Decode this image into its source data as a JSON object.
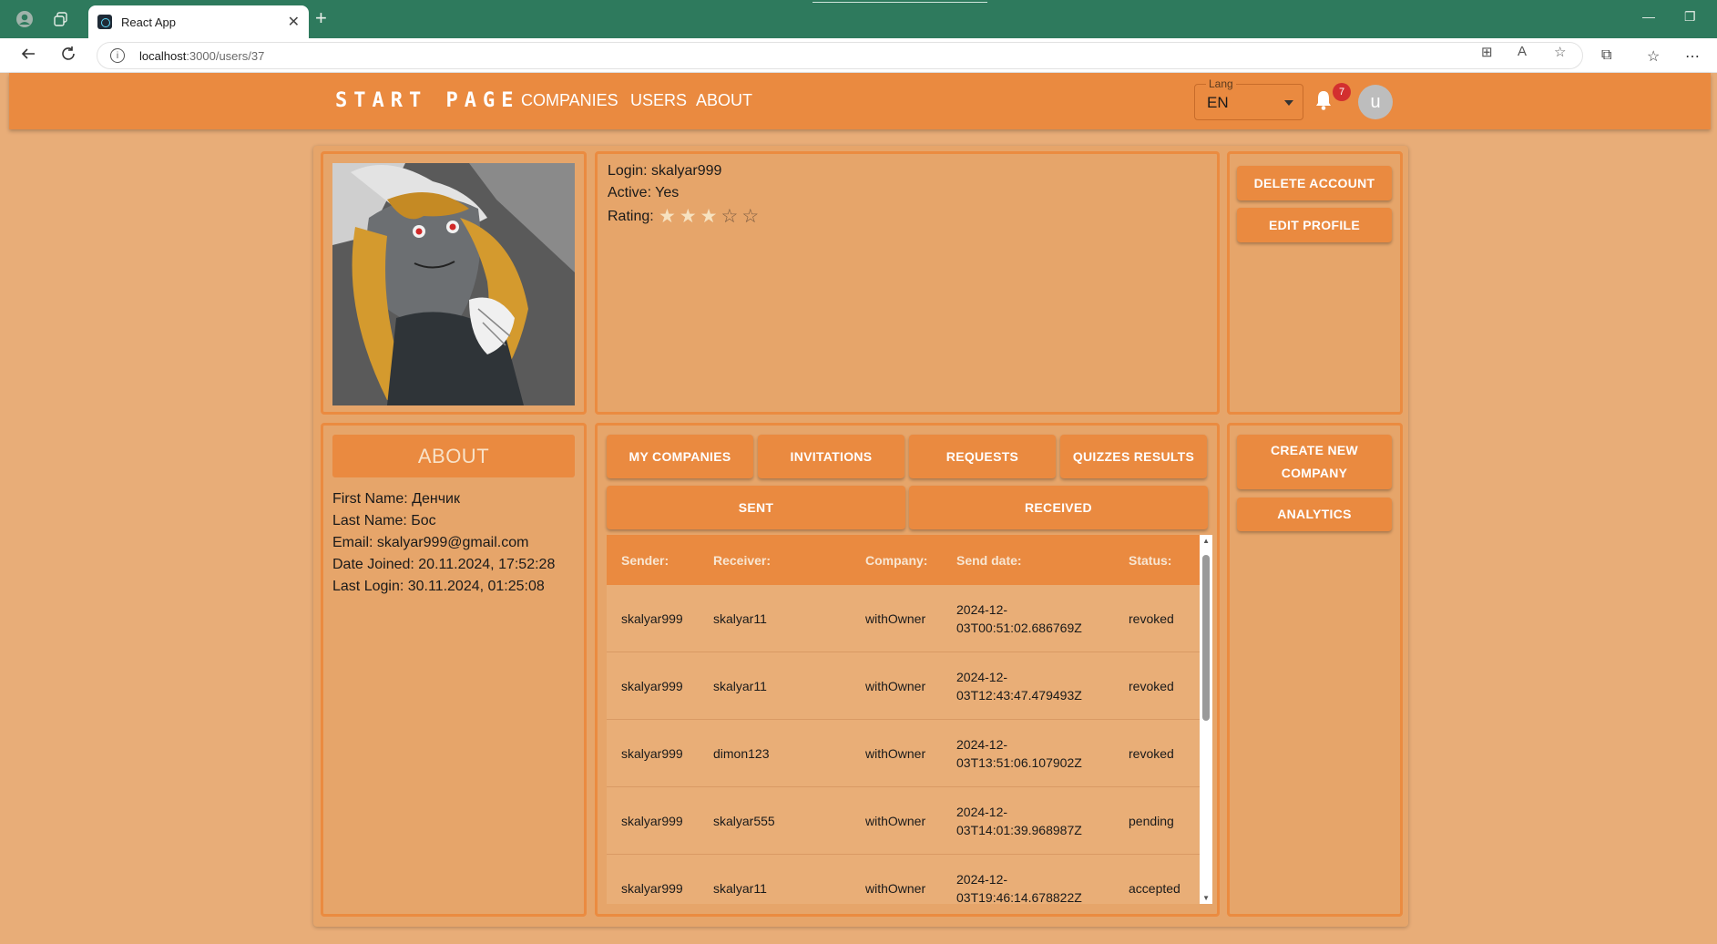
{
  "browser": {
    "tab_title": "React App",
    "url_host": "localhost",
    "url_path": ":3000/users/37"
  },
  "header": {
    "brand": "START PAGE",
    "nav": [
      "COMPANIES",
      "USERS",
      "ABOUT"
    ],
    "lang_label": "Lang",
    "lang_value": "EN",
    "notification_count": "7",
    "avatar_letter": "u"
  },
  "profile": {
    "login_line": "Login: skalyar999",
    "active_line": "Active: Yes",
    "rating_label": "Rating:",
    "rating": 3,
    "rating_max": 5
  },
  "actions_top": {
    "delete_label": "DELETE ACCOUNT",
    "edit_label": "EDIT PROFILE"
  },
  "about": {
    "title": "ABOUT",
    "first_name": "First Name: Денчик",
    "last_name": "Last Name: Бос",
    "email": "Email: skalyar999@gmail.com",
    "date_joined": "Date Joined: 20.11.2024, 17:52:28",
    "last_login": "Last Login: 30.11.2024, 01:25:08"
  },
  "tabs": {
    "main": [
      "MY COMPANIES",
      "INVITATIONS",
      "REQUESTS",
      "QUIZZES RESULTS"
    ],
    "sub": [
      "SENT",
      "RECEIVED"
    ]
  },
  "table": {
    "headers": [
      "Sender:",
      "Receiver:",
      "Company:",
      "Send date:",
      "Status:"
    ],
    "rows": [
      {
        "sender": "skalyar999",
        "receiver": "skalyar11",
        "company": "withOwner",
        "date1": "2024-12-",
        "date2": "03T00:51:02.686769Z",
        "status": "revoked"
      },
      {
        "sender": "skalyar999",
        "receiver": "skalyar11",
        "company": "withOwner",
        "date1": "2024-12-",
        "date2": "03T12:43:47.479493Z",
        "status": "revoked"
      },
      {
        "sender": "skalyar999",
        "receiver": "dimon123",
        "company": "withOwner",
        "date1": "2024-12-",
        "date2": "03T13:51:06.107902Z",
        "status": "revoked"
      },
      {
        "sender": "skalyar999",
        "receiver": "skalyar555",
        "company": "withOwner",
        "date1": "2024-12-",
        "date2": "03T14:01:39.968987Z",
        "status": "pending"
      },
      {
        "sender": "skalyar999",
        "receiver": "skalyar11",
        "company": "withOwner",
        "date1": "2024-12-",
        "date2": "03T19:46:14.678822Z",
        "status": "accepted"
      }
    ]
  },
  "actions_side": {
    "create_line1": "CREATE NEW",
    "create_line2": "COMPANY",
    "analytics_label": "ANALYTICS"
  }
}
